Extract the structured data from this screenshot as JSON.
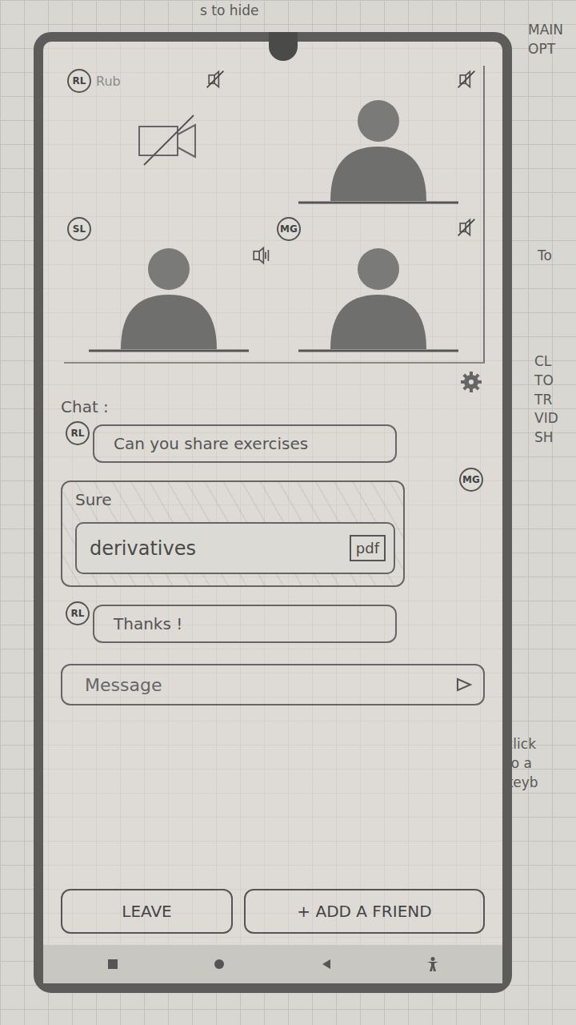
{
  "annotations": [
    {
      "lines": [
        "s to hide"
      ]
    },
    {
      "lines": [
        "MAIN",
        "OPT"
      ]
    },
    {
      "lines": [
        "To"
      ]
    },
    {
      "lines": [
        "CL",
        "TO",
        "TR",
        "VID",
        "SH"
      ]
    },
    {
      "lines": [
        "click",
        "to a",
        "keyb"
      ]
    }
  ],
  "participants": [
    {
      "initials": "RL",
      "name": "Rub",
      "camera": false,
      "muted": true
    },
    {
      "initials": "",
      "name": "",
      "camera": true,
      "muted": true
    },
    {
      "initials": "SL",
      "name": "",
      "camera": true,
      "muted": false
    },
    {
      "initials": "MG",
      "name": "",
      "camera": true,
      "muted": true
    }
  ],
  "chat": {
    "title": "Chat :",
    "messages": [
      {
        "sender": "RL",
        "own": false,
        "kind": "text",
        "text": "Can you share exercises"
      },
      {
        "sender": "MG",
        "own": true,
        "kind": "attachment",
        "text": "Sure",
        "file": {
          "name": "derivatives",
          "type": "pdf"
        }
      },
      {
        "sender": "RL",
        "own": false,
        "kind": "text",
        "text": "Thanks !"
      }
    ]
  },
  "composer": {
    "placeholder": "Message"
  },
  "buttons": [
    {
      "label": "LEAVE"
    },
    {
      "label": "+ ADD A FRIEND"
    }
  ]
}
